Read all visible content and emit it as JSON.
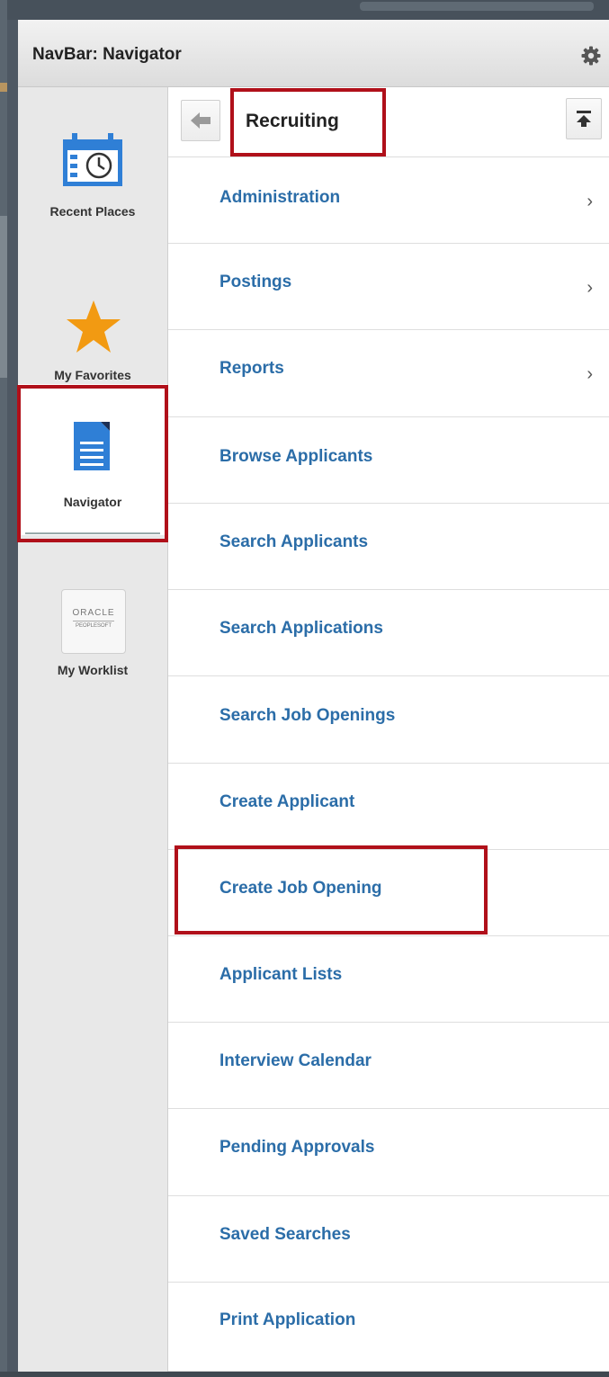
{
  "navbar": {
    "title": "NavBar: Navigator"
  },
  "sidebar": {
    "items": [
      {
        "label": "Recent Places",
        "icon": "calendar-clock-icon"
      },
      {
        "label": "My Favorites",
        "icon": "star-icon"
      },
      {
        "label": "Navigator",
        "icon": "document-icon",
        "active": true
      },
      {
        "label": "My Worklist",
        "icon": "oracle-peoplesoft-logo",
        "logo_text": [
          "ORACLE",
          "PEOPLESOFT"
        ]
      }
    ]
  },
  "content": {
    "folder_title": "Recruiting",
    "items": [
      {
        "label": "Administration",
        "has_children": true
      },
      {
        "label": "Postings",
        "has_children": true
      },
      {
        "label": "Reports",
        "has_children": true
      },
      {
        "label": "Browse Applicants",
        "has_children": false
      },
      {
        "label": "Search Applicants",
        "has_children": false
      },
      {
        "label": "Search Applications",
        "has_children": false
      },
      {
        "label": "Search Job Openings",
        "has_children": false
      },
      {
        "label": "Create Applicant",
        "has_children": false
      },
      {
        "label": "Create Job Opening",
        "has_children": false
      },
      {
        "label": "Applicant Lists",
        "has_children": false
      },
      {
        "label": "Interview Calendar",
        "has_children": false
      },
      {
        "label": "Pending Approvals",
        "has_children": false
      },
      {
        "label": "Saved Searches",
        "has_children": false
      },
      {
        "label": "Print Application",
        "has_children": false
      }
    ],
    "chevron": "›"
  },
  "colors": {
    "link": "#2b6da8",
    "highlight": "#b0101a",
    "star": "#f29a12",
    "doc": "#2f7fd6"
  }
}
